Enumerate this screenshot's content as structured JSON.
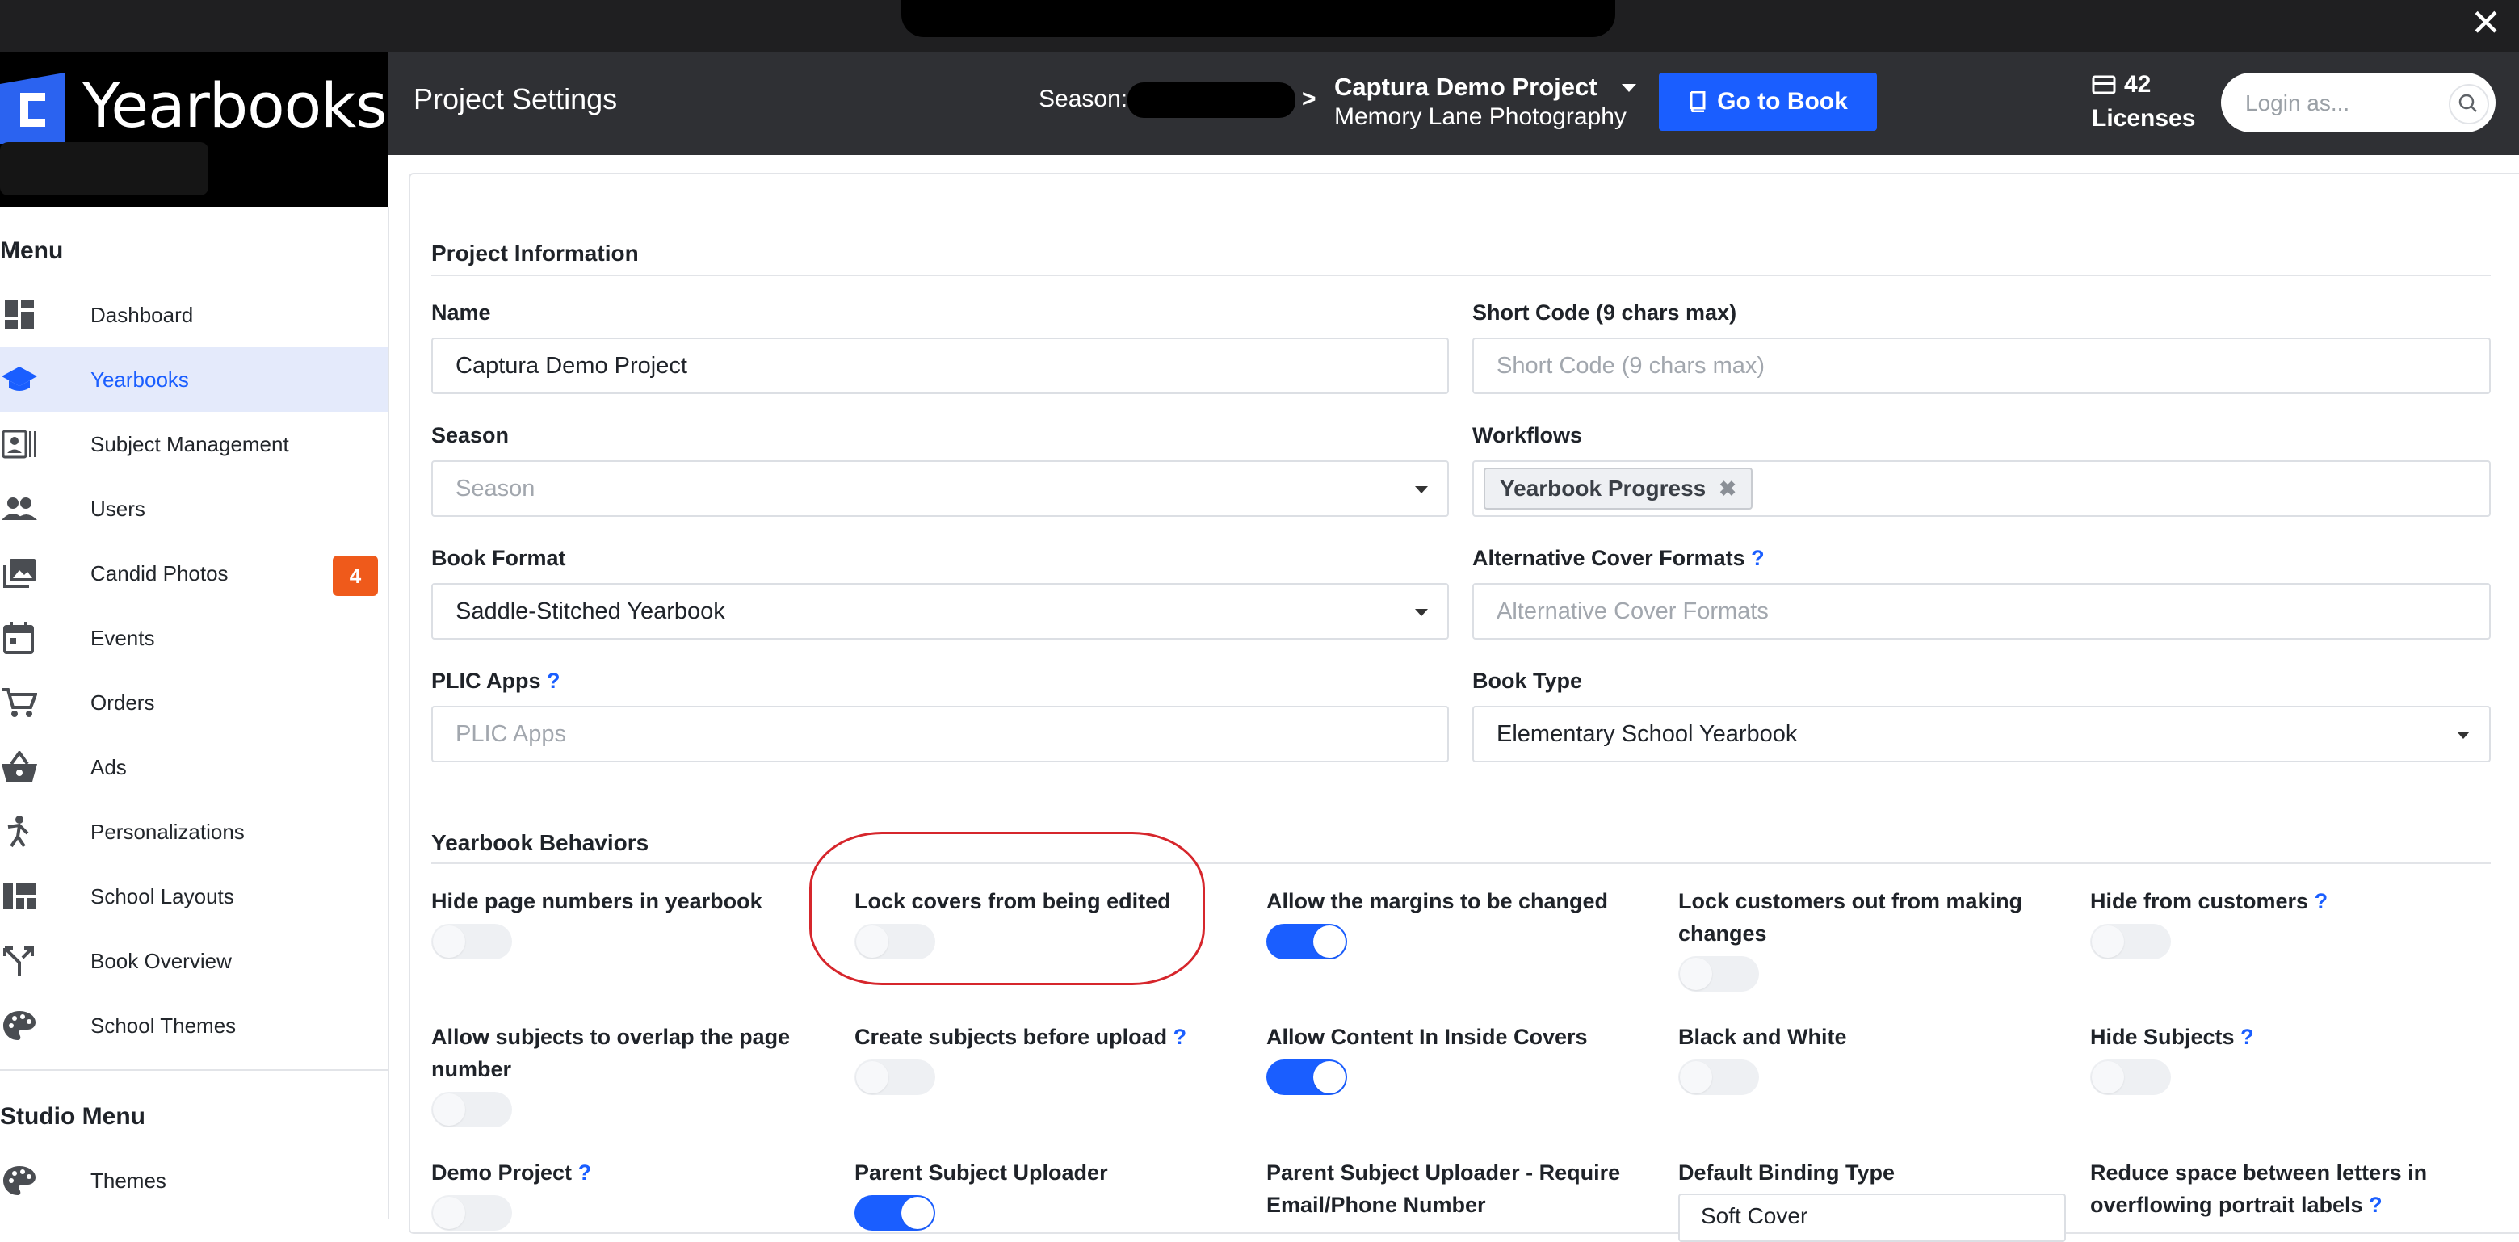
{
  "app": {
    "logo_text": "Yearbooks",
    "close_glyph": "✕"
  },
  "header": {
    "page_title": "Project Settings",
    "season_label": "Season:",
    "project_name": "Captura Demo Project",
    "project_company": "Memory Lane Photography",
    "go_to_book_label": "Go to Book",
    "licenses_count": "42",
    "licenses_label": "Licenses",
    "login_placeholder": "Login as..."
  },
  "sidebar": {
    "menu_heading": "Menu",
    "studio_heading": "Studio Menu",
    "items": [
      {
        "label": "Dashboard",
        "icon": "dashboard-icon"
      },
      {
        "label": "Yearbooks",
        "icon": "graduation-cap-icon",
        "active": true
      },
      {
        "label": "Subject Management",
        "icon": "id-card-icon"
      },
      {
        "label": "Users",
        "icon": "users-icon"
      },
      {
        "label": "Candid Photos",
        "icon": "photos-icon",
        "badge": "4"
      },
      {
        "label": "Events",
        "icon": "calendar-icon"
      },
      {
        "label": "Orders",
        "icon": "cart-icon"
      },
      {
        "label": "Ads",
        "icon": "basket-icon"
      },
      {
        "label": "Personalizations",
        "icon": "person-icon"
      },
      {
        "label": "School Layouts",
        "icon": "layout-icon"
      },
      {
        "label": "Book Overview",
        "icon": "branch-icon"
      },
      {
        "label": "School Themes",
        "icon": "palette-icon"
      }
    ],
    "studio_items": [
      {
        "label": "Themes",
        "icon": "palette-icon"
      }
    ]
  },
  "project_information": {
    "title": "Project Information",
    "name_label": "Name",
    "name_value": "Captura Demo Project",
    "short_code_label": "Short Code (9 chars max)",
    "short_code_placeholder": "Short Code (9 chars max)",
    "season_label": "Season",
    "season_placeholder": "Season",
    "workflows_label": "Workflows",
    "workflow_tag": "Yearbook Progress",
    "book_format_label": "Book Format",
    "book_format_value": "Saddle-Stitched Yearbook",
    "alt_cover_label": "Alternative Cover Formats",
    "alt_cover_placeholder": "Alternative Cover Formats",
    "plic_label": "PLIC Apps",
    "plic_placeholder": "PLIC Apps",
    "book_type_label": "Book Type",
    "book_type_value": "Elementary School Yearbook",
    "help_mark": "?"
  },
  "yearbook_behaviors": {
    "title": "Yearbook Behaviors",
    "toggles": [
      {
        "label": "Hide page numbers in yearbook",
        "on": false
      },
      {
        "label": "Lock covers from being edited",
        "on": false
      },
      {
        "label": "Allow the margins to be changed",
        "on": true
      },
      {
        "label": "Lock customers out from making changes",
        "on": false
      },
      {
        "label": "Hide from customers",
        "on": false,
        "help": true
      },
      {
        "label": "Allow subjects to overlap the page number",
        "on": false
      },
      {
        "label": "Create subjects before upload",
        "on": false,
        "help": true
      },
      {
        "label": "Allow Content In Inside Covers",
        "on": true
      },
      {
        "label": "Black and White",
        "on": false
      },
      {
        "label": "Hide Subjects",
        "on": false,
        "help": true
      },
      {
        "label": "Demo Project",
        "on": false,
        "help": true
      },
      {
        "label": "Parent Subject Uploader",
        "on": true
      },
      {
        "label": "Parent Subject Uploader - Require Email/Phone Number"
      },
      {
        "label": "Default Binding Type"
      },
      {
        "label": "Reduce space between letters in overflowing portrait labels",
        "help": true
      }
    ],
    "default_binding_value": "Soft Cover"
  },
  "colors": {
    "accent": "#1a5eff",
    "header_bg": "#2f3034",
    "badge": "#ef5a1b",
    "highlight": "#d6262c"
  }
}
